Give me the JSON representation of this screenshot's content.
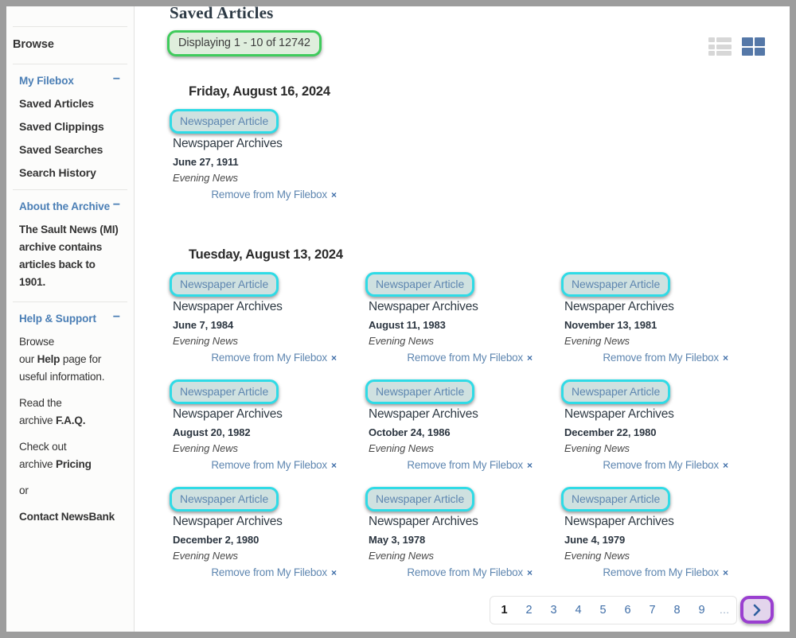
{
  "sidebar": {
    "browse_label": "Browse",
    "sections": [
      {
        "title": "My Filebox",
        "collapse_glyph": "−",
        "items": [
          "Saved Articles",
          "Saved Clippings",
          "Saved Searches",
          "Search History"
        ]
      }
    ],
    "about": {
      "title": "About the Archive",
      "collapse_glyph": "−",
      "line1": "The Sault News (MI)",
      "line2": "archive contains",
      "line3": "articles back to 1901."
    },
    "help": {
      "title": "Help & Support",
      "collapse_glyph": "−",
      "p1_a": "Browse",
      "p1_b": "our ",
      "p1_bold": "Help",
      "p1_c": " page for",
      "p1_d": "useful information.",
      "p2_a": "Read the",
      "p2_b": "archive ",
      "p2_bold": "F.A.Q.",
      "p3_a": "Check out",
      "p3_b": "archive ",
      "p3_bold": "Pricing",
      "p4": "or",
      "p5": "Contact NewsBank"
    }
  },
  "main": {
    "title": "Saved Articles",
    "count_text": "Displaying 1 - 10 of 12742",
    "view_list_icon": "list-view-icon",
    "view_grid_icon": "grid-view-icon",
    "remove_label": "Remove from My Filebox",
    "remove_x": "×",
    "groups": [
      {
        "date": "Friday, August 16, 2024",
        "articles": [
          {
            "type": "Newspaper Article",
            "source": "Newspaper Archives",
            "date": "June 27, 1911",
            "publication": "Evening News"
          }
        ]
      },
      {
        "date": "Tuesday, August 13, 2024",
        "articles": [
          {
            "type": "Newspaper Article",
            "source": "Newspaper Archives",
            "date": "June 7, 1984",
            "publication": "Evening News"
          },
          {
            "type": "Newspaper Article",
            "source": "Newspaper Archives",
            "date": "August 11, 1983",
            "publication": "Evening News"
          },
          {
            "type": "Newspaper Article",
            "source": "Newspaper Archives",
            "date": "November 13, 1981",
            "publication": "Evening News"
          },
          {
            "type": "Newspaper Article",
            "source": "Newspaper Archives",
            "date": "August 20, 1982",
            "publication": "Evening News"
          },
          {
            "type": "Newspaper Article",
            "source": "Newspaper Archives",
            "date": "October 24, 1986",
            "publication": "Evening News"
          },
          {
            "type": "Newspaper Article",
            "source": "Newspaper Archives",
            "date": "December 22, 1980",
            "publication": "Evening News"
          },
          {
            "type": "Newspaper Article",
            "source": "Newspaper Archives",
            "date": "December 2, 1980",
            "publication": "Evening News"
          },
          {
            "type": "Newspaper Article",
            "source": "Newspaper Archives",
            "date": "May 3, 1978",
            "publication": "Evening News"
          },
          {
            "type": "Newspaper Article",
            "source": "Newspaper Archives",
            "date": "June 4, 1979",
            "publication": "Evening News"
          }
        ]
      }
    ]
  },
  "pagination": {
    "pages": [
      "1",
      "2",
      "3",
      "4",
      "5",
      "6",
      "7",
      "8",
      "9"
    ],
    "current": "1",
    "ellipsis": "…",
    "next_icon": "chevron-right-icon"
  },
  "colors": {
    "accent_link": "#5e86b0",
    "sidebar_heading": "#4a7eb5",
    "highlight_green": "#3fcb5c",
    "highlight_cyan": "#2fdbe6",
    "highlight_purple": "#9a3fd0",
    "grid_icon_active": "#5578a8",
    "list_icon_inactive": "#d7d7d7"
  }
}
